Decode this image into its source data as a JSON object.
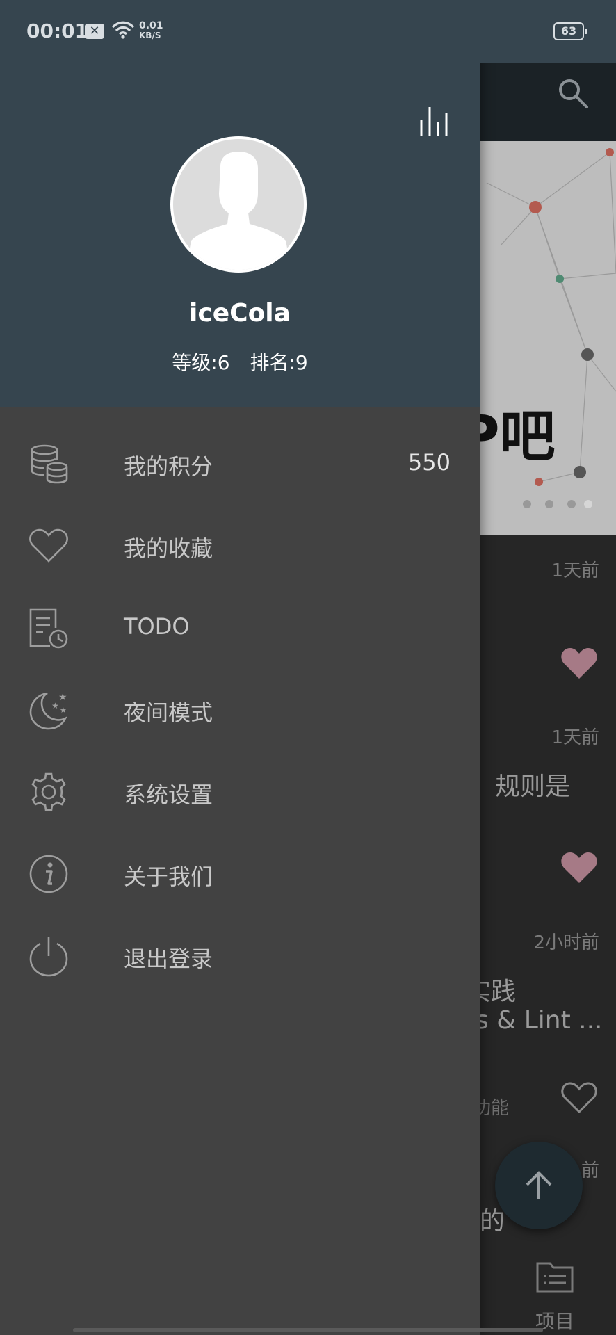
{
  "status_bar": {
    "time": "00:01",
    "net_speed_value": "0.01",
    "net_speed_unit": "KB/S",
    "battery": "63"
  },
  "drawer": {
    "username": "iceCola",
    "level": "等级:6",
    "rank": "排名:9",
    "menu": [
      {
        "label": "我的积分",
        "value": "550",
        "icon": "coins-icon"
      },
      {
        "label": "我的收藏",
        "icon": "heart-outline-icon"
      },
      {
        "label": "TODO",
        "icon": "todo-doc-icon"
      },
      {
        "label": "夜间模式",
        "icon": "moon-stars-icon"
      },
      {
        "label": "系统设置",
        "icon": "gear-icon"
      },
      {
        "label": "关于我们",
        "icon": "info-icon"
      },
      {
        "label": "退出登录",
        "icon": "power-icon"
      }
    ]
  },
  "main": {
    "banner_text": "P吧",
    "articles": [
      {
        "time": "1天前",
        "title": "",
        "favorited": true
      },
      {
        "time": "1天前",
        "title": "，规则是",
        "favorited": true
      },
      {
        "time": "2小时前",
        "title": "实践",
        "title2": "s & Lint ...",
        "tag": "功能",
        "favorited": false
      },
      {
        "time": "前",
        "title": "的"
      }
    ],
    "bottom_nav_label": "项目"
  },
  "colors": {
    "header_bg": "#36454f",
    "drawer_bg": "#424242",
    "favorite_heart": "#a67a86"
  }
}
